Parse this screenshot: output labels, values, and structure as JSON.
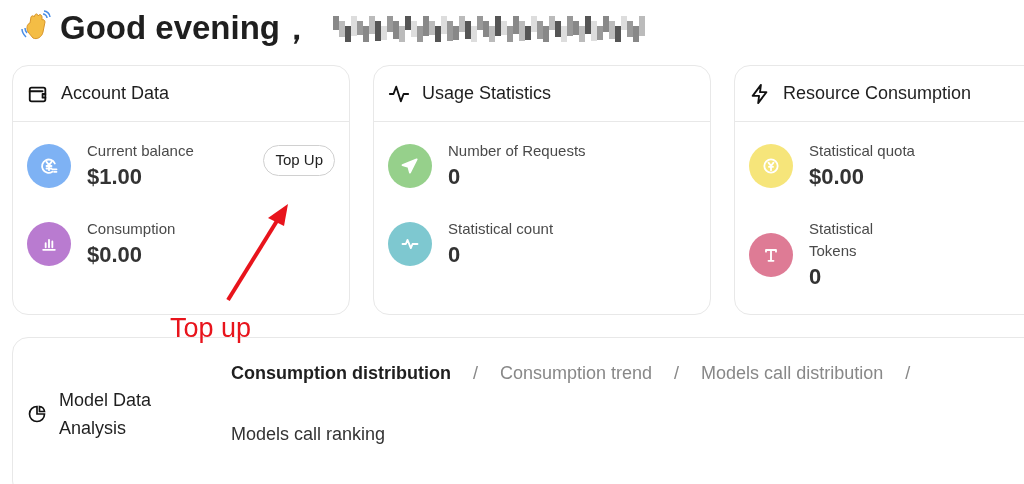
{
  "greeting": {
    "title": "Good evening，"
  },
  "cards": [
    {
      "title": "Account Data",
      "kind": "wallet",
      "items": [
        {
          "label": "Current balance",
          "value": "$1.00",
          "kind": "exchange",
          "color": "#7eb2f4",
          "action": "Top Up"
        },
        {
          "label": "Consumption",
          "value": "$0.00",
          "kind": "bars",
          "color": "#b97bd0"
        }
      ]
    },
    {
      "title": "Usage Statistics",
      "kind": "pulse",
      "items": [
        {
          "label": "Number of Requests",
          "value": "0",
          "kind": "send",
          "color": "#96d08b"
        },
        {
          "label": "Statistical count",
          "value": "0",
          "kind": "pulse",
          "color": "#7ec8d0"
        }
      ]
    },
    {
      "title": "Resource Consumption",
      "kind": "bolt",
      "items": [
        {
          "label": "Statistical quota",
          "value": "$0.00",
          "kind": "coin",
          "color": "#f6e57a"
        },
        {
          "label": "Statistical Tokens",
          "value": "0",
          "kind": "letter",
          "color": "#de7b95"
        }
      ]
    }
  ],
  "annotation": {
    "text": "Top up"
  },
  "analysis": {
    "title": "Model Data Analysis",
    "separator": "/",
    "tabs": [
      {
        "label": "Consumption distribution",
        "selected": true
      },
      {
        "label": "Consumption trend",
        "selected": false
      },
      {
        "label": "Models call distribution",
        "selected": false
      },
      {
        "label": "Models call ranking",
        "selected": false
      }
    ]
  }
}
